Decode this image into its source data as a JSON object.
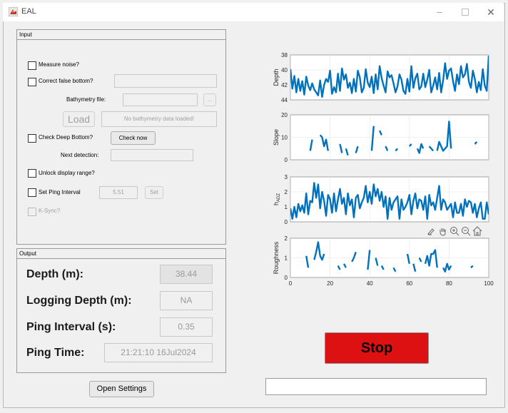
{
  "window": {
    "title": "EAL"
  },
  "input_panel": {
    "title": "Input",
    "measure_noise_label": "Measure noise?",
    "correct_false_bottom_label": "Correct false bottom?",
    "bathymetry_file_label": "Bathymetry file:",
    "browse_label": "...",
    "load_label": "Load",
    "bathy_status": "No bathymetry data loaded!",
    "check_deep_bottom_label": "Check Deep Bottom?",
    "check_now_label": "Check now",
    "next_detection_label": "Next detection:",
    "unlock_display_label": "Unlock display range?",
    "set_ping_interval_label": "Set Ping Interval",
    "ping_interval_value": "5.51",
    "set_label": "Set",
    "ksync_label": "K-Sync?"
  },
  "output_panel": {
    "title": "Output",
    "depth_label": "Depth (m):",
    "depth_value": "38.44",
    "logging_depth_label": "Logging Depth (m):",
    "logging_depth_value": "NA",
    "ping_interval_label": "Ping Interval (s):",
    "ping_interval_value": "0.35",
    "ping_time_label": "Ping Time:",
    "ping_time_value": "21:21:10 16Jul2024"
  },
  "open_settings_label": "Open Settings",
  "stop_label": "Stop",
  "colors": {
    "line": "#0072bd",
    "stop": "#dd1111"
  },
  "toolbar_icons": [
    "brush-icon",
    "pan-icon",
    "zoom-in-icon",
    "zoom-out-icon",
    "home-icon"
  ],
  "chart_data": [
    {
      "type": "line",
      "ylabel": "Depth",
      "ylim": [
        38,
        44
      ],
      "y_reversed": true,
      "yticks": [
        38,
        40,
        42,
        44
      ],
      "xlim": [
        0,
        100
      ],
      "grid": true,
      "series": [
        {
          "x": [
            0,
            1,
            2,
            3,
            4,
            5,
            6,
            7,
            8,
            9,
            10,
            11,
            12,
            13,
            14,
            15,
            16,
            17,
            18,
            19,
            20,
            21,
            22,
            23,
            24,
            25,
            26,
            27,
            28,
            29,
            30,
            31,
            32,
            33,
            34,
            35,
            36,
            37,
            38,
            39,
            40,
            41,
            42,
            43,
            44,
            45,
            46,
            47,
            48,
            49,
            50,
            51,
            52,
            53,
            54,
            55,
            56,
            57,
            58,
            59,
            60,
            61,
            62,
            63,
            64,
            65,
            66,
            67,
            68,
            69,
            70,
            71,
            72,
            73,
            74,
            75,
            76,
            77,
            78,
            79,
            80,
            81,
            82,
            83,
            84,
            85,
            86,
            87,
            88,
            89,
            90,
            91,
            92,
            93,
            94,
            95,
            96,
            97,
            98,
            99,
            100
          ],
          "values": [
            39.9,
            42.5,
            40.8,
            43.0,
            41.2,
            42.8,
            41.5,
            43.3,
            40.9,
            42.1,
            42.7,
            41.8,
            42.6,
            43.0,
            43.4,
            41.4,
            43.6,
            42.0,
            41.2,
            41.6,
            40.1,
            43.2,
            42.3,
            43.0,
            40.5,
            42.8,
            39.8,
            41.3,
            40.6,
            42.4,
            41.7,
            43.1,
            41.2,
            42.9,
            40.1,
            41.0,
            43.0,
            42.4,
            39.9,
            41.7,
            42.3,
            40.9,
            43.1,
            40.6,
            42.6,
            39.5,
            41.1,
            42.1,
            43.0,
            40.2,
            41.0,
            40.7,
            41.8,
            43.0,
            42.2,
            40.6,
            41.3,
            42.8,
            43.2,
            41.2,
            42.9,
            39.5,
            42.4,
            41.1,
            40.5,
            42.6,
            42.2,
            40.5,
            42.3,
            41.3,
            40.0,
            43.0,
            42.1,
            41.0,
            42.6,
            40.4,
            43.0,
            41.4,
            39.1,
            41.2,
            40.1,
            39.8,
            41.5,
            42.8,
            40.6,
            41.9,
            39.5,
            41.0,
            40.6,
            39.2,
            41.6,
            42.4,
            40.1,
            41.2,
            43.0,
            41.6,
            42.7,
            39.9,
            42.1,
            42.8,
            38.1
          ]
        }
      ]
    },
    {
      "type": "line",
      "ylabel": "Slope",
      "ylim": [
        0,
        20
      ],
      "yticks": [
        0,
        10,
        20
      ],
      "xlim": [
        0,
        100
      ],
      "grid": true,
      "series": [
        {
          "segments": [
            [
              [
                10,
                4
              ],
              [
                11,
                9
              ]
            ],
            [
              [
                15,
                11
              ],
              [
                16,
                10
              ],
              [
                17,
                6
              ],
              [
                18,
                9
              ],
              [
                19,
                4
              ]
            ],
            [
              [
                25,
                7
              ],
              [
                26,
                3
              ]
            ],
            [
              [
                28,
                5
              ],
              [
                29,
                2
              ]
            ],
            [
              [
                33,
                3
              ],
              [
                34,
                6
              ]
            ],
            [
              [
                41,
                4
              ],
              [
                42,
                15
              ]
            ],
            [
              [
                45,
                13
              ],
              [
                46,
                11
              ]
            ],
            [
              [
                48,
                6
              ],
              [
                49,
                4
              ]
            ],
            [
              [
                53,
                4
              ],
              [
                54,
                5
              ]
            ],
            [
              [
                60,
                6
              ],
              [
                61,
                7
              ]
            ],
            [
              [
                64,
                5
              ],
              [
                65,
                3
              ],
              [
                66,
                7
              ],
              [
                67,
                5
              ]
            ],
            [
              [
                70,
                6
              ],
              [
                71,
                5
              ],
              [
                72,
                4
              ]
            ],
            [
              [
                74,
                4
              ],
              [
                75,
                8
              ],
              [
                76,
                6
              ],
              [
                77,
                4
              ],
              [
                78,
                5
              ],
              [
                79,
                6
              ],
              [
                80,
                17
              ],
              [
                81,
                5
              ]
            ],
            [
              [
                93,
                7
              ],
              [
                94,
                8
              ]
            ]
          ]
        }
      ]
    },
    {
      "type": "line",
      "ylabel": "h_ADZ",
      "ylim": [
        0,
        3
      ],
      "yticks": [
        0,
        1,
        2,
        3
      ],
      "xlim": [
        0,
        100
      ],
      "grid": true,
      "series": [
        {
          "x": [
            0,
            1,
            2,
            3,
            4,
            5,
            6,
            7,
            8,
            9,
            10,
            11,
            12,
            13,
            14,
            15,
            16,
            17,
            18,
            19,
            20,
            21,
            22,
            23,
            24,
            25,
            26,
            27,
            28,
            29,
            30,
            31,
            32,
            33,
            34,
            35,
            36,
            37,
            38,
            39,
            40,
            41,
            42,
            43,
            44,
            45,
            46,
            47,
            48,
            49,
            50,
            51,
            52,
            53,
            54,
            55,
            56,
            57,
            58,
            59,
            60,
            61,
            62,
            63,
            64,
            65,
            66,
            67,
            68,
            69,
            70,
            71,
            72,
            73,
            74,
            75,
            76,
            77,
            78,
            79,
            80,
            81,
            82,
            83,
            84,
            85,
            86,
            87,
            88,
            89,
            90,
            91,
            92,
            93,
            94,
            95,
            96,
            97,
            98,
            99,
            100
          ],
          "values": [
            0.9,
            0.2,
            1.0,
            0.3,
            1.2,
            0.7,
            1.1,
            0.6,
            1.9,
            0.5,
            1.4,
            1.3,
            2.6,
            1.6,
            2.5,
            0.9,
            2.0,
            1.4,
            0.4,
            1.8,
            1.5,
            0.6,
            1.9,
            0.7,
            1.5,
            2.2,
            1.2,
            1.6,
            0.5,
            1.9,
            1.1,
            1.5,
            0.3,
            1.6,
            1.8,
            0.9,
            1.3,
            1.6,
            2.4,
            1.3,
            2.0,
            1.2,
            2.5,
            1.7,
            2.2,
            1.4,
            2.0,
            1.0,
            1.7,
            0.2,
            1.6,
            0.8,
            1.3,
            1.5,
            1.7,
            0.2,
            1.5,
            0.8,
            1.0,
            1.3,
            1.8,
            0.5,
            1.4,
            1.9,
            0.9,
            1.5,
            1.4,
            0.8,
            1.7,
            0.2,
            1.8,
            1.1,
            1.3,
            0.8,
            1.6,
            2.4,
            0.8,
            1.5,
            1.3,
            0.8,
            1.0,
            1.2,
            0.3,
            1.3,
            0.6,
            0.6,
            1.2,
            0.4,
            1.5,
            1.0,
            1.4,
            1.3,
            0.6,
            1.2,
            0.3,
            0.9,
            1.3,
            0.2,
            0.2,
            1.3,
            0.5
          ]
        }
      ]
    },
    {
      "type": "line",
      "ylabel": "Roughness",
      "ylim": [
        0,
        2
      ],
      "yticks": [
        0,
        1,
        2
      ],
      "xlim": [
        0,
        100
      ],
      "xticks": [
        0,
        20,
        40,
        60,
        80,
        100
      ],
      "grid": true,
      "series": [
        {
          "segments": [
            [
              [
                8,
                1.1
              ],
              [
                9,
                0.5
              ]
            ],
            [
              [
                12,
                0.9
              ],
              [
                13,
                1.3
              ],
              [
                14,
                1.8
              ],
              [
                15,
                1.1
              ],
              [
                16,
                0.9
              ],
              [
                17,
                1.2
              ]
            ],
            [
              [
                24,
                0.6
              ],
              [
                25,
                0.4
              ]
            ],
            [
              [
                27,
                0.7
              ],
              [
                28,
                0.5
              ]
            ],
            [
              [
                31,
                0.8
              ],
              [
                32,
                1.0
              ],
              [
                33,
                1.3
              ]
            ],
            [
              [
                39,
                0.4
              ],
              [
                40,
                1.4
              ]
            ],
            [
              [
                43,
                1.0
              ],
              [
                44,
                0.6
              ]
            ],
            [
              [
                46,
                0.6
              ],
              [
                47,
                0.4
              ]
            ],
            [
              [
                52,
                0.5
              ],
              [
                53,
                0.3
              ]
            ],
            [
              [
                59,
                1.2
              ],
              [
                60,
                0.7
              ]
            ],
            [
              [
                62,
                0.7
              ],
              [
                63,
                0.3
              ]
            ],
            [
              [
                65,
                1.0
              ],
              [
                66,
                0.8
              ]
            ],
            [
              [
                68,
                0.7
              ],
              [
                69,
                1.1
              ],
              [
                70,
                0.6
              ],
              [
                71,
                1.2
              ],
              [
                72,
                1.2
              ],
              [
                73,
                1.4
              ],
              [
                74,
                0.5
              ]
            ],
            [
              [
                77,
                0.5
              ],
              [
                78,
                0.3
              ],
              [
                79,
                0.7
              ],
              [
                80,
                0.4
              ],
              [
                81,
                0.6
              ]
            ],
            [
              [
                91,
                0.5
              ],
              [
                92,
                0.6
              ]
            ]
          ]
        }
      ]
    }
  ]
}
